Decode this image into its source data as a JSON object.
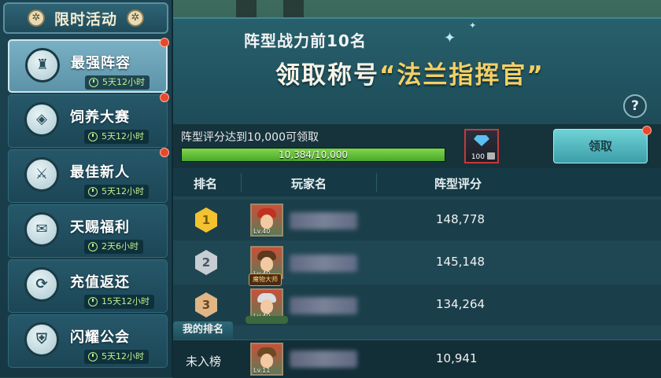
{
  "sidebar": {
    "title": "限时活动",
    "items": [
      {
        "label": "最强阵容",
        "time": "5天12小时",
        "icon": "tower-icon",
        "active": true
      },
      {
        "label": "饲养大赛",
        "time": "5天12小时",
        "icon": "feed-icon"
      },
      {
        "label": "最佳新人",
        "time": "5天12小时",
        "icon": "crossed-swords-icon"
      },
      {
        "label": "天赐福利",
        "time": "2天6小时",
        "icon": "gift-icon"
      },
      {
        "label": "充值返还",
        "time": "15天12小时",
        "icon": "recharge-icon"
      },
      {
        "label": "闪耀公会",
        "time": "5天12小时",
        "icon": "guild-shield-icon"
      }
    ]
  },
  "banner": {
    "subtitle": "阵型战力前10名",
    "main_prefix": "领取称号",
    "main_title": "“法兰指挥官”",
    "help": "?"
  },
  "requirement": {
    "text": "阵型评分达到10,000可领取",
    "progress_label": "10,384/10,000",
    "progress_fraction": 1.0,
    "reward_count": "100",
    "claim_label": "领取"
  },
  "table": {
    "headers": {
      "rank": "排名",
      "player": "玩家名",
      "score": "阵型评分"
    },
    "rows": [
      {
        "rank": "1",
        "level": "Lv.40",
        "score": "148,778"
      },
      {
        "rank": "2",
        "level": "Lv.40",
        "score": "145,148"
      },
      {
        "rank": "3",
        "level": "Lv.40",
        "score": "134,264",
        "title_tag": "魔物大师"
      }
    ],
    "mine": {
      "tab": "我的排名",
      "rank": "未入榜",
      "level": "Lv.11",
      "score": "10,941"
    }
  },
  "colors": {
    "accent_gold": "#f6d064",
    "progress": "#6cc83c",
    "notice": "#e8482c"
  }
}
